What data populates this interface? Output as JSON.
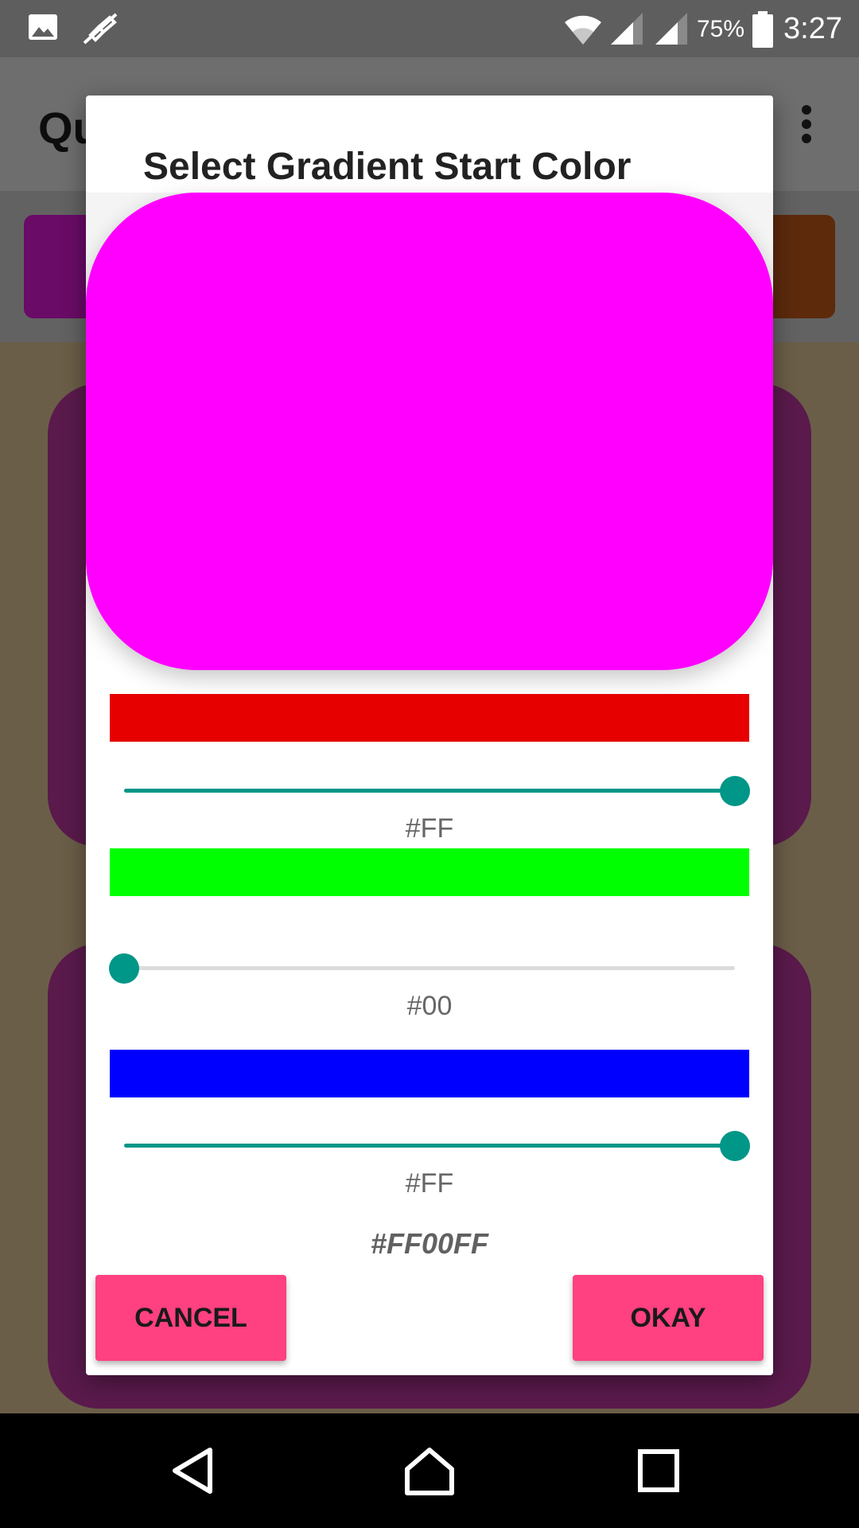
{
  "status_bar": {
    "battery_percent": "75%",
    "time": "3:27",
    "icons": [
      "gallery-icon",
      "mute-icon",
      "wifi-icon",
      "signal-icon",
      "signal-icon",
      "battery-icon"
    ]
  },
  "background_app": {
    "title": "Qu",
    "overflow_icon": "more-vert-icon"
  },
  "dialog": {
    "title": "Select Gradient Start Color",
    "preview_color": "#FF00FF",
    "channels": [
      {
        "name": "red",
        "swatch_color": "#E60000",
        "value": 255,
        "label": "#FF"
      },
      {
        "name": "green",
        "swatch_color": "#00FF00",
        "value": 0,
        "label": "#00"
      },
      {
        "name": "blue",
        "swatch_color": "#0000FF",
        "value": 255,
        "label": "#FF"
      }
    ],
    "hex_value": "#FF00FF",
    "cancel_label": "CANCEL",
    "okay_label": "OKAY",
    "accent_color": "#009688",
    "button_color": "#FF4081"
  },
  "nav_bar": {
    "icons": [
      "back-icon",
      "home-icon",
      "recents-icon"
    ]
  }
}
